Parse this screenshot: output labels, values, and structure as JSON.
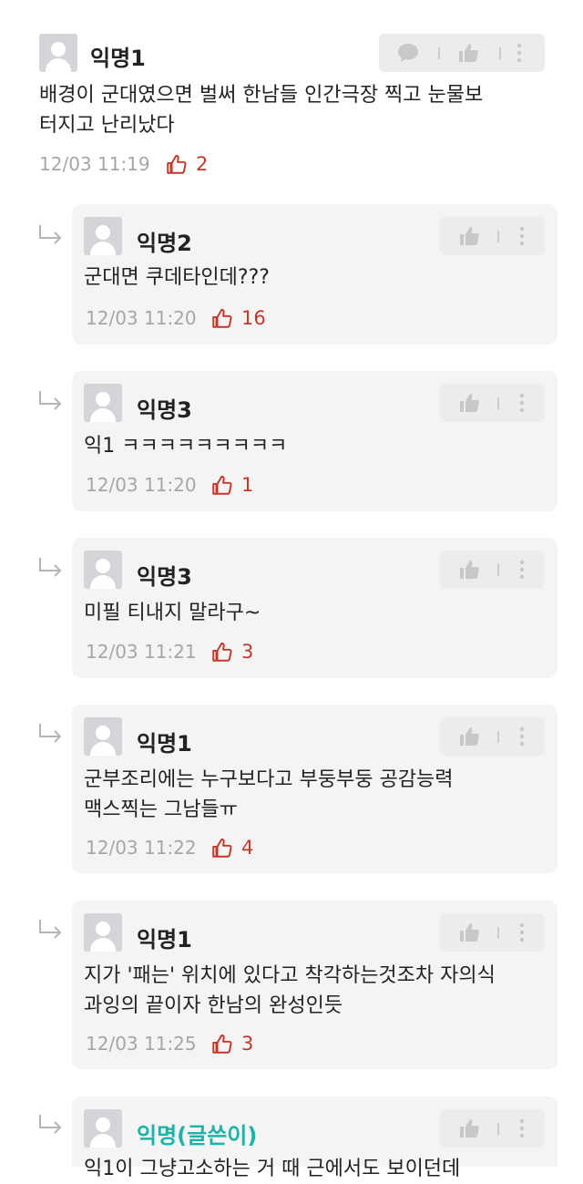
{
  "comments": [
    {
      "author": "익명1",
      "lines": [
        "배경이 군대였으면 벌써 한남들 인간극장 찍고 눈물보",
        "터지고 난리났다"
      ],
      "time": "12/03 11:19",
      "likes": "2"
    }
  ],
  "replies": [
    {
      "author": "익명2",
      "lines": [
        "군대면 쿠데타인데???"
      ],
      "time": "12/03 11:20",
      "likes": "16"
    },
    {
      "author": "익명3",
      "lines": [
        "익1 ㅋㅋㅋㅋㅋㅋㅋㅋㅋ"
      ],
      "time": "12/03 11:20",
      "likes": "1"
    },
    {
      "author": "익명3",
      "lines": [
        "미필 티내지 말라구~"
      ],
      "time": "12/03 11:21",
      "likes": "3"
    },
    {
      "author": "익명1",
      "lines": [
        "군부조리에는 누구보다고 부둥부둥 공감능력",
        "맥스찍는 그남들ㅠ"
      ],
      "time": "12/03 11:22",
      "likes": "4"
    },
    {
      "author": "익명1",
      "lines": [
        "지가 '패는' 위치에 있다고 착각하는것조차 자의식",
        "과잉의 끝이자 한남의 완성인듯"
      ],
      "time": "12/03 11:25",
      "likes": "3"
    },
    {
      "author": "익명(글쓴이)",
      "lines": [
        "익1이 그냥고소하는 거 때 근에서도 보이던데"
      ],
      "time": "",
      "likes": ""
    }
  ],
  "colors": {
    "author_name": "#1fb3a8",
    "like": "#c0392b",
    "card_bg": "#f4f4f4",
    "action_bar_bg": "#ececec",
    "timestamp": "#a6a6a6"
  },
  "icons": [
    "avatar",
    "chat-bubble-icon",
    "thumbs-up-icon",
    "more-vertical-icon",
    "like-outline-icon",
    "reply-arrow-icon"
  ]
}
